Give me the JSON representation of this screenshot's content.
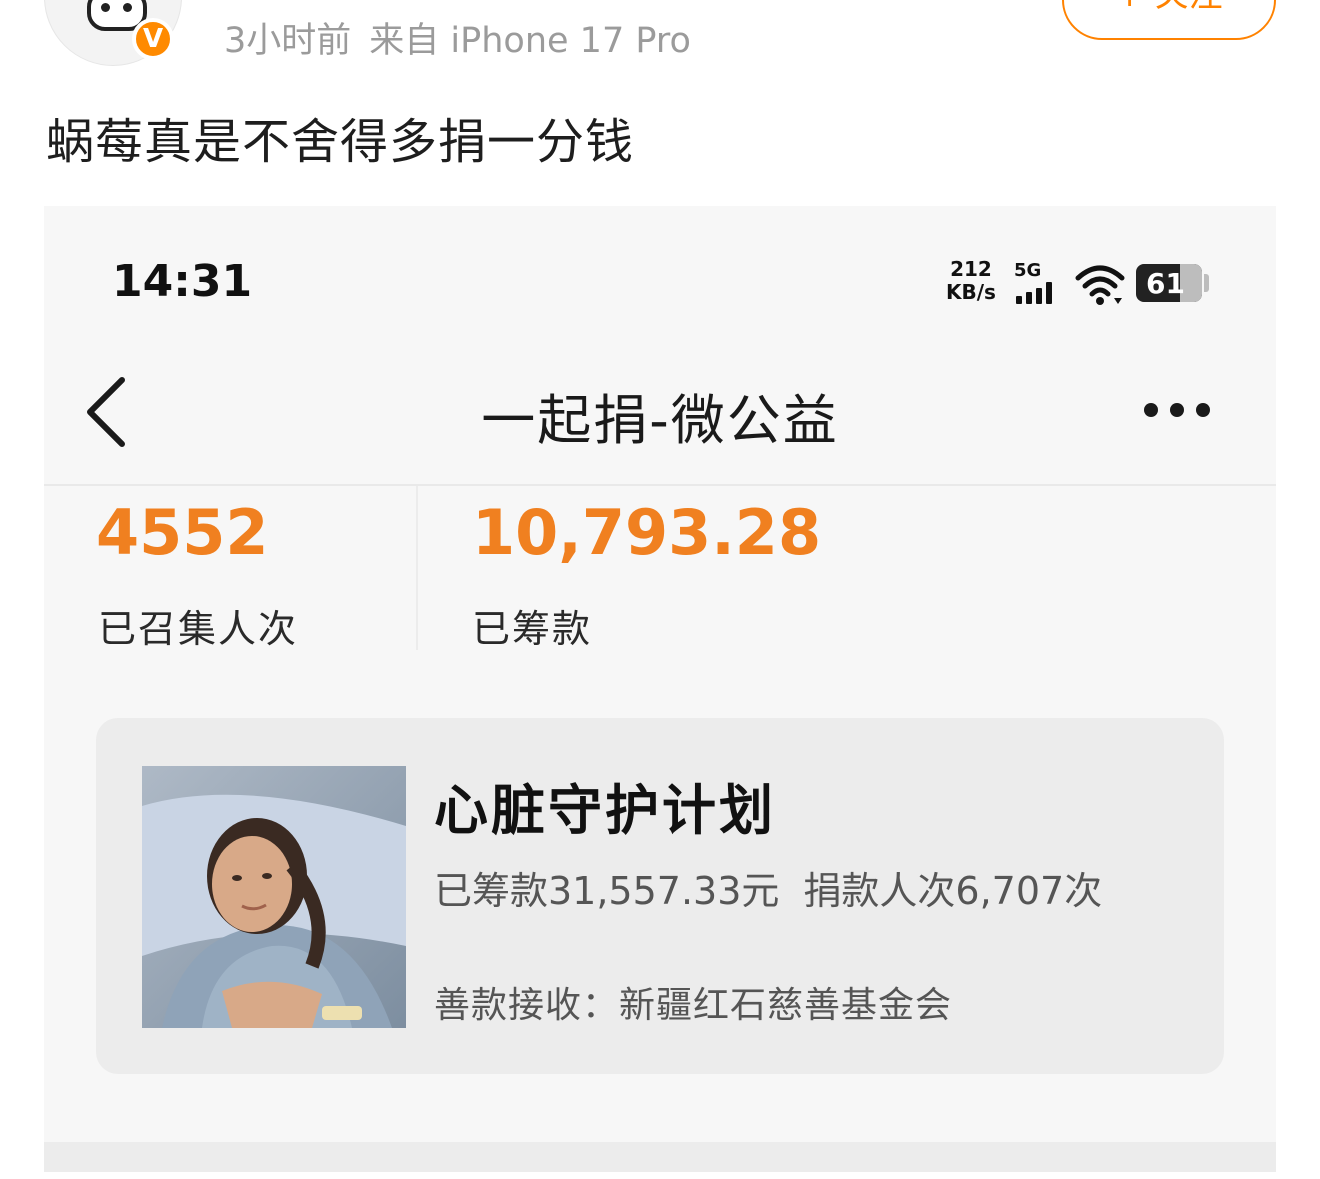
{
  "post": {
    "meta_time": "3小时前",
    "meta_source": "来自 iPhone 17 Pro",
    "follow_label": "+ 关注",
    "verified_badge": "V",
    "text": "蜗莓真是不舍得多捐一分钱"
  },
  "screenshot": {
    "status_bar": {
      "time": "14:31",
      "speed_value": "212",
      "speed_unit": "KB/s",
      "network": "5G",
      "battery": "61"
    },
    "nav": {
      "title": "一起捐-微公益"
    },
    "stats": [
      {
        "value": "4552",
        "label": "已召集人次"
      },
      {
        "value": "10,793.28",
        "label": "已筹款"
      }
    ],
    "project_card": {
      "title": "心脏守护计划",
      "raised": "已筹款31,557.33元",
      "donors": "捐款人次6,707次",
      "recipient": "善款接收：新疆红石慈善基金会"
    }
  },
  "colors": {
    "accent_orange": "#f08020",
    "weibo_orange": "#ff8200",
    "card_bg": "#ececec",
    "page_bg": "#f7f7f7"
  },
  "icons": [
    "avatar",
    "verified-badge-icon",
    "signal-icon",
    "wifi-icon",
    "battery-icon",
    "back-chevron-icon",
    "more-dots-icon",
    "patient-photo"
  ]
}
